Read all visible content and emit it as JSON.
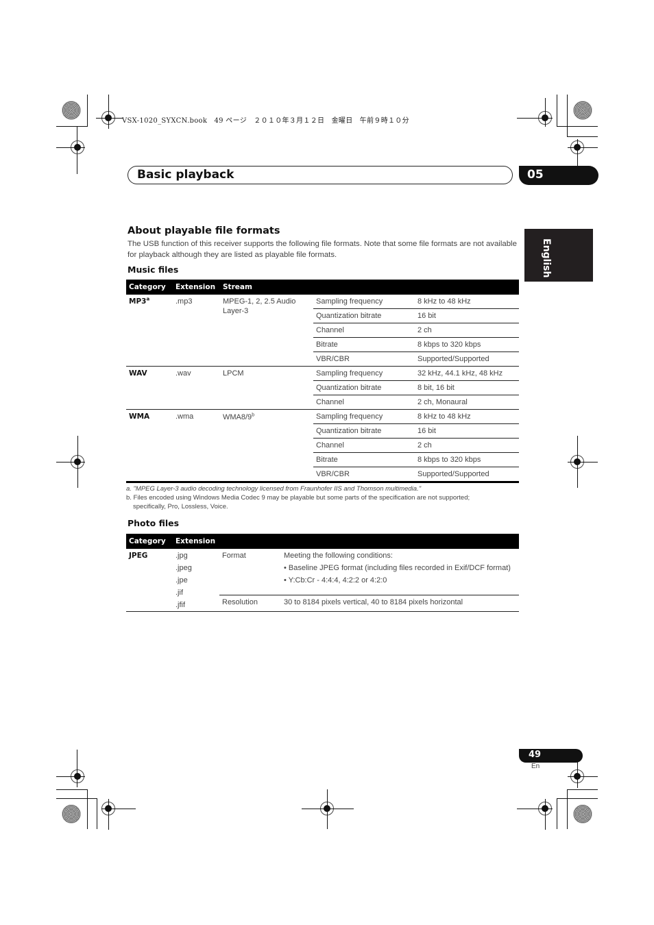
{
  "print_header": "VSX-1020_SYXCN.book　49 ページ　２０１０年３月１２日　金曜日　午前９時１０分",
  "chapter": {
    "title": "Basic playback",
    "number": "05"
  },
  "language_tab": "English",
  "section": {
    "title": "About playable file formats",
    "intro": "The USB function of this receiver supports the following file formats. Note that some file formats are not available for playback although they are listed as playable file formats."
  },
  "music": {
    "title": "Music files",
    "headers": [
      "Category",
      "Extension",
      "Stream"
    ],
    "groups": [
      {
        "category": "MP3",
        "category_note": "a",
        "extension": ".mp3",
        "stream": "MPEG-1, 2, 2.5 Audio Layer-3",
        "stream_note": "",
        "properties": [
          {
            "name": "Sampling frequency",
            "value": "8 kHz to 48 kHz"
          },
          {
            "name": "Quantization bitrate",
            "value": "16 bit"
          },
          {
            "name": "Channel",
            "value": "2 ch"
          },
          {
            "name": "Bitrate",
            "value": "8 kbps to 320 kbps"
          },
          {
            "name": "VBR/CBR",
            "value": "Supported/Supported"
          }
        ]
      },
      {
        "category": "WAV",
        "category_note": "",
        "extension": ".wav",
        "stream": "LPCM",
        "stream_note": "",
        "properties": [
          {
            "name": "Sampling frequency",
            "value": "32 kHz, 44.1 kHz, 48 kHz"
          },
          {
            "name": "Quantization bitrate",
            "value": "8 bit, 16 bit"
          },
          {
            "name": "Channel",
            "value": "2 ch, Monaural"
          }
        ]
      },
      {
        "category": "WMA",
        "category_note": "",
        "extension": ".wma",
        "stream": "WMA8/9",
        "stream_note": "b",
        "properties": [
          {
            "name": "Sampling frequency",
            "value": "8 kHz to 48 kHz"
          },
          {
            "name": "Quantization bitrate",
            "value": "16 bit"
          },
          {
            "name": "Channel",
            "value": "2 ch"
          },
          {
            "name": "Bitrate",
            "value": "8 kbps to 320 kbps"
          },
          {
            "name": "VBR/CBR",
            "value": "Supported/Supported"
          }
        ]
      }
    ],
    "footnotes": {
      "a": "a. \"MPEG Layer-3 audio decoding technology licensed from Fraunhofer IIS and Thomson multimedia.\"",
      "b_line1": "b. Files encoded using Windows Media Codec 9 may be playable but some parts of the specification are not supported;",
      "b_line2": "specifically, Pro, Lossless, Voice."
    }
  },
  "photo": {
    "title": "Photo files",
    "headers": [
      "Category",
      "Extension"
    ],
    "category": "JPEG",
    "extensions": [
      ".jpg",
      ".jpeg",
      ".jpe",
      ".jif",
      ".jfif"
    ],
    "format_label": "Format",
    "format_lines": [
      "Meeting the following conditions:",
      "• Baseline JPEG format (including files recorded in Exif/DCF format)",
      "• Y:Cb:Cr - 4:4:4, 4:2:2 or 4:2:0"
    ],
    "resolution_label": "Resolution",
    "resolution_value": "30 to 8184 pixels vertical, 40 to 8184 pixels horizontal"
  },
  "footer": {
    "page_number": "49",
    "page_lang": "En"
  }
}
